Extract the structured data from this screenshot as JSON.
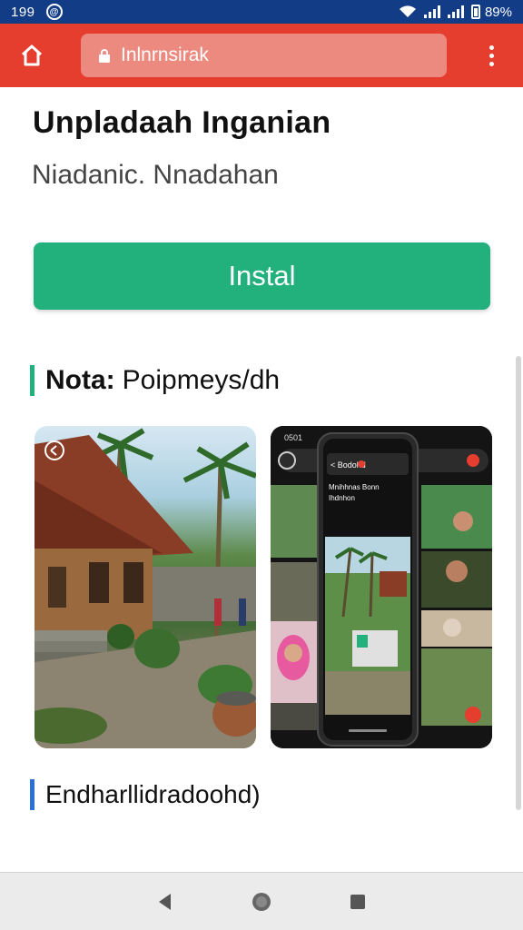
{
  "status_bar": {
    "time": "199",
    "notification": "@",
    "battery": "89%"
  },
  "toolbar": {
    "url": "Inlnrnsirak"
  },
  "page": {
    "title": "Unpladaah Inganian",
    "subtitle": "Niadanic. Nnadahan",
    "install_label": "Instal",
    "notes_label": "Nota:",
    "notes_value": "Poipmeys/dh",
    "more_label": "Endharllidradoohd)"
  },
  "screenshot2": {
    "status_time": "0501",
    "header": "< Bodohd",
    "caption": "Mnihhnas Bonn\nIhdnhon"
  },
  "colors": {
    "status_bar": "#123c86",
    "toolbar": "#e53e2f",
    "install": "#22b07d",
    "notes_accent": "#22b07d",
    "more_accent": "#2c6fd6"
  },
  "icons": {
    "home": "home-icon",
    "lock": "lock-icon",
    "menu": "more-vert-icon",
    "back": "nav-back-icon",
    "home_nav": "nav-home-icon",
    "recents": "nav-recents-icon"
  }
}
